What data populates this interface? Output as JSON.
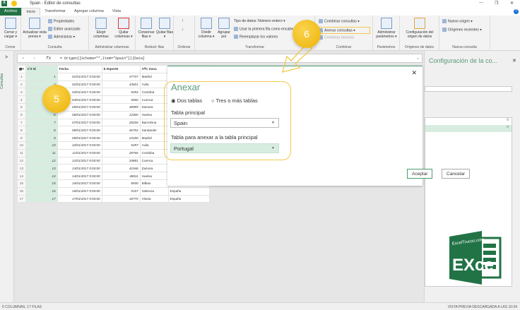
{
  "window": {
    "title": "Spain - Editor de consultas",
    "minimize": "—",
    "restore": "❐",
    "close": "✕",
    "help": "?"
  },
  "tabs": [
    "Archivo",
    "Inicio",
    "Transformar",
    "Agregar columna",
    "Vista"
  ],
  "ribbon": {
    "cerrar": {
      "button": "Cerrar y cargar ▾",
      "group": "Cerrar"
    },
    "consulta": {
      "actualizar": "Actualizar vista previa ▾",
      "propiedades": "Propiedades",
      "editor": "Editor avanzado",
      "administrar": "Administrar ▾",
      "group": "Consulta"
    },
    "columnas": {
      "elegir": "Elegir columnas",
      "quitar": "Quitar columnas ▾",
      "group": "Administrar columnas"
    },
    "filas": {
      "conservar": "Conservar filas ▾",
      "quitar": "Quitar filas ▾",
      "group": "Reducir filas"
    },
    "ordenar": {
      "group": "Ordenar"
    },
    "transformar": {
      "dividir": "Dividir columna ▾",
      "agrupar": "Agrupar por",
      "tipo": "Tipo de datos: Número entero ▾",
      "primera": "Usar la primera fila como encabezado ▾",
      "reemplazar": "Reemplazar los valores",
      "group": "Transformar"
    },
    "combinar": {
      "combinar": "Combinar consultas ▾",
      "anexar": "Anexar consultas ▾",
      "binarios": "Combinar binarios",
      "group": "Combinar"
    },
    "parametros": {
      "button": "Administrar parámetros ▾",
      "group": "Parámetros"
    },
    "origenes": {
      "button": "Configuración del origen de datos",
      "group": "Orígenes de datos"
    },
    "nueva": {
      "nuevo": "Nuevo origen ▾",
      "recientes": "Orígenes recientes ▾",
      "group": "Nueva consulta"
    }
  },
  "sidebar": {
    "toggle": ">",
    "label": "Consultas"
  },
  "formula": {
    "cancel": "✕",
    "confirm": "✓",
    "fx": "fx",
    "text": "= Origen{[Schema=\"\",Item=\"Spain\"]}[Data]"
  },
  "grid": {
    "headers": [
      "1²3 Id",
      "Fecha",
      "$ Importe",
      "AᴮC Zona"
    ],
    "rows": [
      [
        "1",
        "1",
        "01/01/2017 0:00:00",
        "47737",
        "Madrid",
        ""
      ],
      [
        "2",
        "2",
        "02/01/2017 0:00:00",
        "43601",
        "Avila",
        ""
      ],
      [
        "3",
        "3",
        "03/01/2017 0:00:00",
        "9494",
        "Cordoba",
        ""
      ],
      [
        "4",
        "4",
        "04/01/2017 0:00:00",
        "5000",
        "Cuenca",
        ""
      ],
      [
        "5",
        "5",
        "05/01/2017 0:00:00",
        "48989",
        "Zamora",
        ""
      ],
      [
        "6",
        "6",
        "06/01/2017 0:00:00",
        "12000",
        "Huelva",
        ""
      ],
      [
        "7",
        "7",
        "07/01/2017 0:00:00",
        "28206",
        "Barcelona",
        ""
      ],
      [
        "8",
        "8",
        "08/01/2017 0:00:00",
        "46702",
        "Santander",
        ""
      ],
      [
        "9",
        "9",
        "09/01/2017 0:00:00",
        "23180",
        "Madrid",
        ""
      ],
      [
        "10",
        "10",
        "10/01/2017 0:00:00",
        "5497",
        "Avila",
        ""
      ],
      [
        "11",
        "11",
        "11/01/2017 0:00:00",
        "28766",
        "Cordoba",
        ""
      ],
      [
        "12",
        "12",
        "12/01/2017 0:00:00",
        "34881",
        "Cuenca",
        ""
      ],
      [
        "13",
        "13",
        "13/01/2017 0:00:00",
        "41946",
        "Zamora",
        ""
      ],
      [
        "14",
        "14",
        "14/01/2017 0:00:00",
        "48811",
        "Huelva",
        ""
      ],
      [
        "15",
        "15",
        "15/01/2017 0:00:00",
        "8930",
        "Bilbao",
        ""
      ],
      [
        "16",
        "16",
        "16/01/2017 0:00:00",
        "9157",
        "Valencia",
        "España"
      ],
      [
        "17",
        "17",
        "17/01/2017 0:00:00",
        "18770",
        "Vitoria",
        "España"
      ]
    ]
  },
  "dialog": {
    "title": "Anexar",
    "close": "✕",
    "option1": "Dos tablas",
    "option2": "Tres o más tablas",
    "principal_label": "Tabla principal",
    "principal_value": "Spain",
    "anexar_label": "Tabla para anexar a la tabla principal",
    "anexar_value": "Portugal",
    "accept": "Aceptar",
    "cancel": "Cancelar"
  },
  "panel": {
    "title": "Configuración de la co...",
    "close": "✕"
  },
  "badges": {
    "five": "5",
    "six": "6"
  },
  "logo": {
    "text": "ExcelTrucos.com",
    "letters": "EXcel"
  },
  "status": {
    "left": "5 COLUMNAS, 17 FILAS",
    "right": "VISTA PREVIA DESCARGADA A LAS 10:34"
  },
  "colors": {
    "accent": "#217346",
    "highlight": "#f2c84b",
    "selected": "#d7ede0"
  }
}
